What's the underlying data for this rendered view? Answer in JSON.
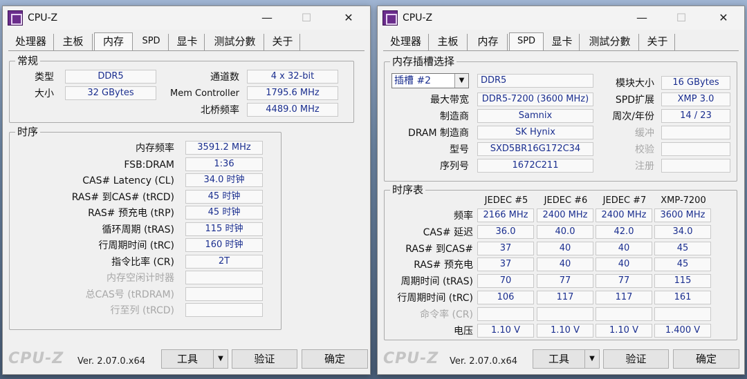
{
  "left": {
    "title": "CPU-Z",
    "tabs": [
      "处理器",
      "主板",
      "内存",
      "SPD",
      "显卡",
      "测試分數",
      "关于"
    ],
    "general": {
      "title": "常规",
      "type_label": "类型",
      "type_value": "DDR5",
      "size_label": "大小",
      "size_value": "32 GBytes",
      "channels_label": "通道数",
      "channels_value": "4 x 32-bit",
      "memctrl_label": "Mem Controller",
      "memctrl_value": "1795.6 MHz",
      "nb_label": "北桥频率",
      "nb_value": "4489.0 MHz"
    },
    "timings": {
      "title": "时序",
      "rows": [
        {
          "label": "内存频率",
          "value": "3591.2 MHz",
          "enabled": true
        },
        {
          "label": "FSB:DRAM",
          "value": "1:36",
          "enabled": true
        },
        {
          "label": "CAS# Latency (CL)",
          "value": "34.0 时钟",
          "enabled": true
        },
        {
          "label": "RAS# 到CAS# (tRCD)",
          "value": "45 时钟",
          "enabled": true
        },
        {
          "label": "RAS# 预充电 (tRP)",
          "value": "45 时钟",
          "enabled": true
        },
        {
          "label": "循环周期 (tRAS)",
          "value": "115 时钟",
          "enabled": true
        },
        {
          "label": "行周期时间 (tRC)",
          "value": "160 时钟",
          "enabled": true
        },
        {
          "label": "指令比率 (CR)",
          "value": "2T",
          "enabled": true
        },
        {
          "label": "内存空闲计时器",
          "value": "",
          "enabled": false
        },
        {
          "label": "总CAS号 (tRDRAM)",
          "value": "",
          "enabled": false
        },
        {
          "label": "行至列 (tRCD)",
          "value": "",
          "enabled": false
        }
      ]
    },
    "footer": {
      "brand": "CPU-Z",
      "version": "Ver. 2.07.0.x64",
      "tools": "工具",
      "validate": "验证",
      "ok": "确定"
    }
  },
  "right": {
    "title": "CPU-Z",
    "tabs": [
      "处理器",
      "主板",
      "内存",
      "SPD",
      "显卡",
      "测試分數",
      "关于"
    ],
    "slot": {
      "title": "内存插槽选择",
      "selected": "插槽 #2",
      "type_value": "DDR5",
      "fields_left": [
        {
          "label": "最大带宽",
          "value": "DDR5-7200 (3600 MHz)"
        },
        {
          "label": "制造商",
          "value": "Samnix"
        },
        {
          "label": "DRAM 制造商",
          "value": "SK Hynix"
        },
        {
          "label": "型号",
          "value": "SXD5BR16G172C34"
        },
        {
          "label": "序列号",
          "value": "1672C211"
        }
      ],
      "fields_right": [
        {
          "label": "模块大小",
          "value": "16 GBytes",
          "enabled": true
        },
        {
          "label": "SPD扩展",
          "value": "XMP 3.0",
          "enabled": true
        },
        {
          "label": "周次/年份",
          "value": "14 / 23",
          "enabled": true
        },
        {
          "label": "缓冲",
          "value": "",
          "enabled": false
        },
        {
          "label": "校验",
          "value": "",
          "enabled": false
        },
        {
          "label": "注册",
          "value": "",
          "enabled": false
        }
      ]
    },
    "timing_table": {
      "title": "时序表",
      "columns": [
        "JEDEC #5",
        "JEDEC #6",
        "JEDEC #7",
        "XMP-7200"
      ],
      "rows": [
        {
          "label": "频率",
          "values": [
            "2166 MHz",
            "2400 MHz",
            "2400 MHz",
            "3600 MHz"
          ],
          "enabled": true
        },
        {
          "label": "CAS# 延迟",
          "values": [
            "36.0",
            "40.0",
            "42.0",
            "34.0"
          ],
          "enabled": true
        },
        {
          "label": "RAS# 到CAS#",
          "values": [
            "37",
            "40",
            "40",
            "45"
          ],
          "enabled": true
        },
        {
          "label": "RAS# 预充电",
          "values": [
            "37",
            "40",
            "40",
            "45"
          ],
          "enabled": true
        },
        {
          "label": "周期时间 (tRAS)",
          "values": [
            "70",
            "77",
            "77",
            "115"
          ],
          "enabled": true
        },
        {
          "label": "行周期时间 (tRC)",
          "values": [
            "106",
            "117",
            "117",
            "161"
          ],
          "enabled": true
        },
        {
          "label": "命令率 (CR)",
          "values": [
            "",
            "",
            "",
            ""
          ],
          "enabled": false
        },
        {
          "label": "电压",
          "values": [
            "1.10 V",
            "1.10 V",
            "1.10 V",
            "1.400 V"
          ],
          "enabled": true
        }
      ]
    },
    "footer": {
      "brand": "CPU-Z",
      "version": "Ver. 2.07.0.x64",
      "tools": "工具",
      "validate": "验证",
      "ok": "确定"
    }
  },
  "window_controls": {
    "minimize": "—",
    "maximize": "☐",
    "close": "✕"
  }
}
